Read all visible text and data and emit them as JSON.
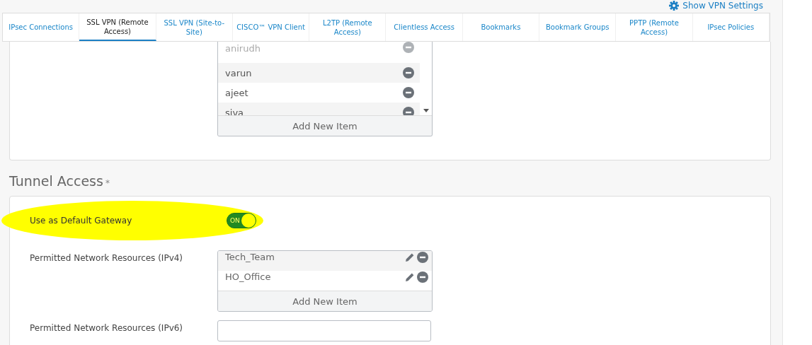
{
  "header_link": {
    "label": "Show VPN Settings"
  },
  "tabs": [
    {
      "label": "IPsec Connections",
      "selected": false
    },
    {
      "label": "SSL VPN (Remote Access)",
      "selected": true
    },
    {
      "label": "SSL VPN (Site-to-Site)",
      "selected": false
    },
    {
      "label": "CISCO™ VPN Client",
      "selected": false
    },
    {
      "label": "L2TP (Remote Access)",
      "selected": false
    },
    {
      "label": "Clientless Access",
      "selected": false
    },
    {
      "label": "Bookmarks",
      "selected": false
    },
    {
      "label": "Bookmark Groups",
      "selected": false
    },
    {
      "label": "PPTP (Remote Access)",
      "selected": false
    },
    {
      "label": "IPsec Policies",
      "selected": false
    }
  ],
  "users_list": {
    "items": [
      {
        "name": "anirudh",
        "disabled": true
      },
      {
        "name": "varun",
        "disabled": false
      },
      {
        "name": "ajeet",
        "disabled": false
      },
      {
        "name": "siva",
        "disabled": false
      }
    ],
    "add_label": "Add New Item"
  },
  "tunnel_access": {
    "title": "Tunnel Access",
    "required_mark": "*",
    "default_gateway": {
      "label": "Use as Default Gateway",
      "on": true,
      "state_label": "ON",
      "highlighted": true
    },
    "ipv4": {
      "label": "Permitted Network Resources (IPv4)",
      "items": [
        "Tech_Team",
        "HO_Office"
      ],
      "add_label": "Add New Item"
    },
    "ipv6": {
      "label": "Permitted Network Resources (IPv6)"
    }
  }
}
